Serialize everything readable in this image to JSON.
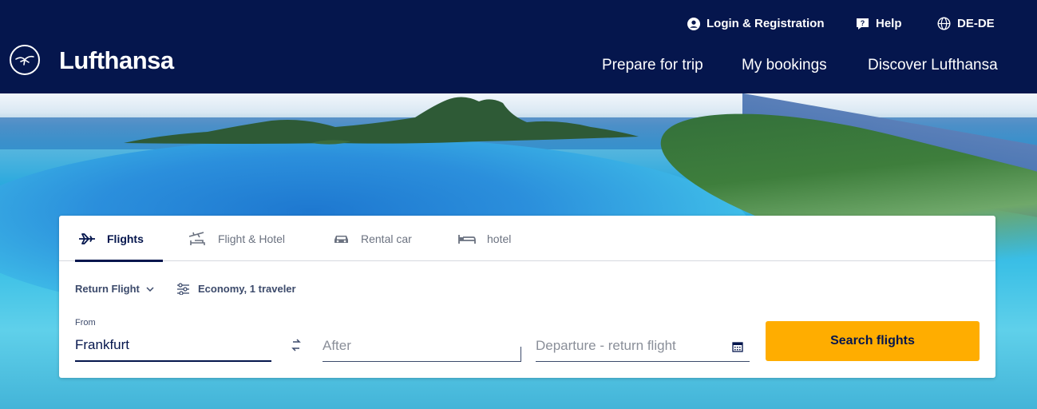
{
  "header": {
    "brand": "Lufthansa",
    "utility": {
      "login": "Login & Registration",
      "help": "Help",
      "language": "DE-DE"
    },
    "nav": [
      "Prepare for trip",
      "My bookings",
      "Discover Lufthansa"
    ]
  },
  "search": {
    "tabs": [
      {
        "label": "Flights",
        "icon": "airplane-icon",
        "active": true
      },
      {
        "label": "Flight & Hotel",
        "icon": "flight-hotel-icon",
        "active": false
      },
      {
        "label": "Rental car",
        "icon": "car-icon",
        "active": false
      },
      {
        "label": "hotel",
        "icon": "bed-icon",
        "active": false
      }
    ],
    "trip_type": "Return Flight",
    "passengers": "Economy, 1 traveler",
    "from_label": "From",
    "from_value": "Frankfurt",
    "to_placeholder": "After",
    "date_placeholder": "Departure - return flight",
    "submit_label": "Search flights"
  },
  "colors": {
    "brand_navy": "#05164d",
    "accent_yellow": "#ffad00"
  }
}
